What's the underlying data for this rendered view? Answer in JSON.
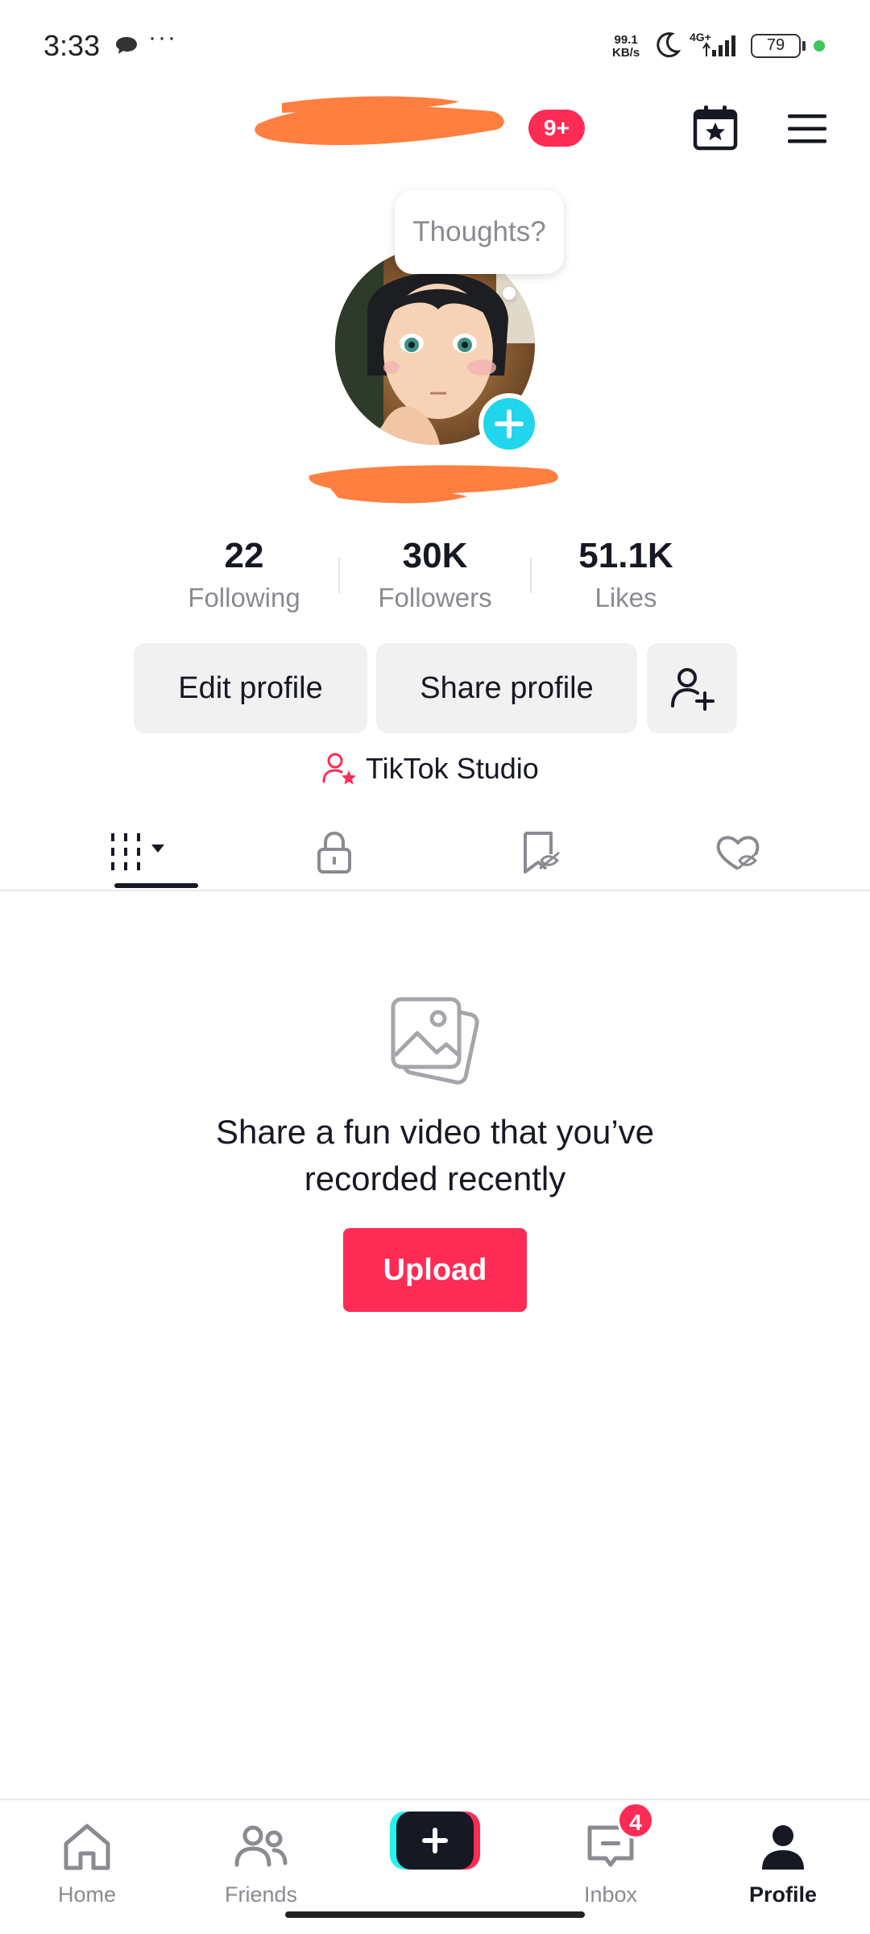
{
  "status_bar": {
    "time": "3:33",
    "overflow": "···",
    "speed_value": "99.1",
    "speed_unit": "KB/s",
    "network": "4G+",
    "battery": "79",
    "icons": [
      "chat-icon",
      "moon-icon",
      "signal-icon",
      "battery-icon"
    ]
  },
  "header": {
    "notification_badge": "9+",
    "icons": [
      "calendar-star-icon",
      "menu-icon"
    ]
  },
  "avatar": {
    "thought_prompt": "Thoughts?"
  },
  "stats": [
    {
      "value": "22",
      "label": "Following"
    },
    {
      "value": "30K",
      "label": "Followers"
    },
    {
      "value": "51.1K",
      "label": "Likes"
    }
  ],
  "actions": {
    "edit_profile": "Edit profile",
    "share_profile": "Share profile",
    "add_friend_icon": "add-user-icon"
  },
  "studio": {
    "label": "TikTok Studio"
  },
  "tabs": [
    {
      "icon": "grid-icon",
      "active": true
    },
    {
      "icon": "lock-icon",
      "active": false
    },
    {
      "icon": "bookmark-hidden-icon",
      "active": false
    },
    {
      "icon": "heart-hidden-icon",
      "active": false
    }
  ],
  "empty_state": {
    "line1": "Share a fun video that you’ve",
    "line2": "recorded recently",
    "button": "Upload"
  },
  "bottom_nav": {
    "items": [
      {
        "label": "Home",
        "icon": "home-icon"
      },
      {
        "label": "Friends",
        "icon": "friends-icon"
      },
      {
        "label": "",
        "icon": "create-plus-icon"
      },
      {
        "label": "Inbox",
        "icon": "inbox-icon",
        "badge": "4"
      },
      {
        "label": "Profile",
        "icon": "profile-icon",
        "active": true
      }
    ]
  },
  "colors": {
    "accent": "#fe2c55",
    "cyan": "#20d5ec",
    "text": "#161823",
    "muted": "#8a8b91",
    "button_bg": "#f1f1f2",
    "redaction": "#ff7f40"
  }
}
